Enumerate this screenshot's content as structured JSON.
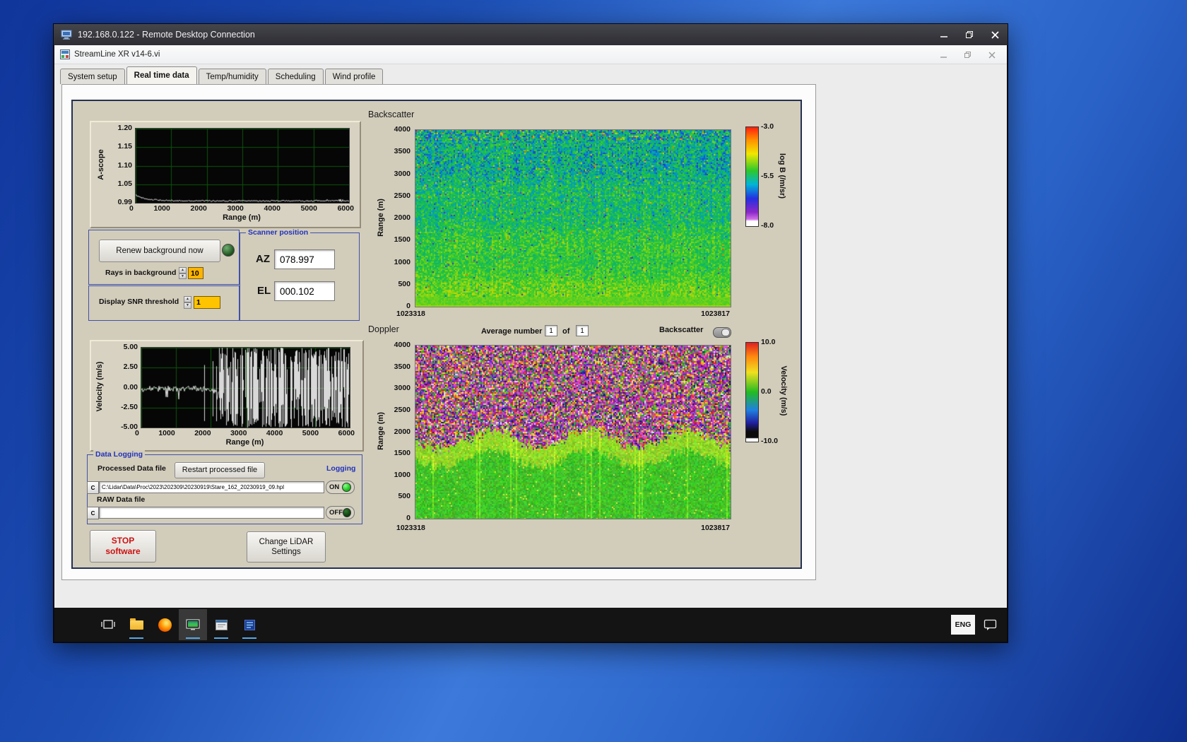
{
  "rdp": {
    "title": "192.168.0.122 - Remote Desktop Connection"
  },
  "app": {
    "title": "StreamLine XR v14-6.vi",
    "tabs": [
      {
        "label": "System setup"
      },
      {
        "label": "Real time data"
      },
      {
        "label": "Temp/humidity"
      },
      {
        "label": "Scheduling"
      },
      {
        "label": "Wind profile"
      }
    ],
    "active_tab": "Real time data"
  },
  "ascope": {
    "ylabel": "A-scope",
    "xlabel": "Range (m)",
    "yticks": [
      "1.20",
      "1.15",
      "1.10",
      "1.05",
      "0.99"
    ],
    "xticks": [
      "0",
      "1000",
      "2000",
      "3000",
      "4000",
      "5000",
      "6000"
    ]
  },
  "bg_controls": {
    "renew_label": "Renew background now",
    "rays_label": "Rays in background",
    "rays_value": "10",
    "snr_label": "Display SNR threshold",
    "snr_value": "1"
  },
  "scanner": {
    "title": "Scanner position",
    "az_label": "AZ",
    "az_value": "078.997",
    "el_label": "EL",
    "el_value": "000.102"
  },
  "vel": {
    "ylabel": "Velocity (m/s)",
    "xlabel": "Range (m)",
    "yticks": [
      "5.00",
      "2.50",
      "0.00",
      "-2.50",
      "-5.00"
    ],
    "xticks": [
      "0",
      "1000",
      "2000",
      "3000",
      "4000",
      "5000",
      "6000"
    ]
  },
  "logging": {
    "title": "Data Logging",
    "processed_label": "Processed Data file",
    "restart_label": "Restart processed file",
    "logging_label": "Logging",
    "drive_label": "C",
    "processed_path": "C:\\Lidar\\Data\\Proc\\2023\\202309\\20230919\\Stare_162_20230919_09.hpl",
    "on_label": "ON",
    "raw_label": "RAW Data file",
    "raw_path": "",
    "off_label": "OFF"
  },
  "actions": {
    "stop1": "STOP",
    "stop2": "software",
    "change1": "Change LiDAR",
    "change2": "Settings"
  },
  "bs": {
    "title": "Backscatter",
    "ylabel": "Range (m)",
    "yticks": [
      "4000",
      "3500",
      "3000",
      "2500",
      "2000",
      "1500",
      "1000",
      "500",
      "0"
    ],
    "x_start": "1023318",
    "x_end": "1023817",
    "cbar_label": "log B (/m/sr)",
    "cbar_ticks": [
      "-3.0",
      "-5.5",
      "-8.0"
    ],
    "cbar_stops": [
      "#ff2010 0%",
      "#ff9000 13%",
      "#f0e800 27%",
      "#2cc82c 44%",
      "#00b4d8 58%",
      "#2430e0 72%",
      "#8c28c8 86%",
      "#d070e8 93%",
      "#ffffff 95%",
      "#ffffff 100%"
    ]
  },
  "dp": {
    "title": "Doppler",
    "avg_label": "Average number",
    "avg_value": "1",
    "of_label": "of",
    "count_value": "1",
    "toggle_label": "Backscatter",
    "ylabel": "Range (m)",
    "yticks": [
      "4000",
      "3500",
      "3000",
      "2500",
      "2000",
      "1500",
      "1000",
      "500",
      "0"
    ],
    "x_start": "1023318",
    "x_end": "1023817",
    "cbar_label": "Velocity (m/s)",
    "cbar_ticks": [
      "10.0",
      "0.0",
      "-10.0"
    ],
    "cbar_stops": [
      "#e02020 0%",
      "#ff8810 14%",
      "#f0e020 30%",
      "#22bb22 50%",
      "#2080e0 68%",
      "#2020a0 81%",
      "#0a0a0a 90%",
      "#0a0a0a 96%",
      "#ffffff 97%",
      "#ffffff 100%"
    ]
  },
  "taskbar": {
    "language": "ENG"
  }
}
